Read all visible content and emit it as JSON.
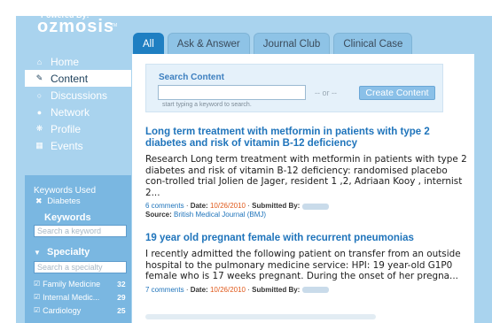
{
  "brand": {
    "powered_by": "Powered By:",
    "name": "ozmosis",
    "tm": "TM"
  },
  "tabs": [
    {
      "label": "All",
      "active": true
    },
    {
      "label": "Ask & Answer",
      "active": false
    },
    {
      "label": "Journal Club",
      "active": false
    },
    {
      "label": "Clinical Case",
      "active": false
    }
  ],
  "nav": [
    {
      "label": "Home",
      "icon": "home-icon",
      "active": false
    },
    {
      "label": "Content",
      "icon": "edit-icon",
      "active": true
    },
    {
      "label": "Discussions",
      "icon": "magnifier-icon",
      "active": false
    },
    {
      "label": "Network",
      "icon": "person-icon",
      "active": false
    },
    {
      "label": "Profile",
      "icon": "profile-gear-icon",
      "active": false
    },
    {
      "label": "Events",
      "icon": "calendar-icon",
      "active": false
    }
  ],
  "keywords_used": {
    "heading": "Keywords Used",
    "tags": [
      "Diabetes"
    ]
  },
  "keywords": {
    "title": "Keywords",
    "placeholder": "Search a keyword"
  },
  "specialty": {
    "title": "Specialty",
    "placeholder": "Search a specialty",
    "items": [
      {
        "name": "Family Medicine",
        "count": "32"
      },
      {
        "name": "Internal Medic...",
        "count": "29"
      },
      {
        "name": "Cardiology",
        "count": "25"
      }
    ]
  },
  "search": {
    "title": "Search Content",
    "hint": "start typing a keyword to search.",
    "or": "-- or --",
    "create_label": "Create Content"
  },
  "articles": [
    {
      "title": "Long term treatment with metformin in patients with type 2 diabetes and risk of vitamin B-12 deficiency",
      "body": "Research Long term treatment with metformin in patients with type 2 diabetes and risk of vitamin B-12 deficiency: randomised placebo con-trolled trial Jolien de Jager, resident 1 ,2, Adriaan Kooy , internist 2...",
      "comments": "6 comments",
      "date_label": "Date:",
      "date": "10/26/2010",
      "submitted_label": "Submitted By:",
      "source_label": "Source:",
      "source": "British Medical Journal (BMJ)"
    },
    {
      "title": "19 year old pregnant female with recurrent pneumonias",
      "body": "I recently admitted the following patient on transfer from an outside hospital to the pulmonary medicine service:   HPI: 19 year-old G1P0 female who is 17 weeks pregnant. During the onset of her pregna...",
      "comments": "7 comments",
      "date_label": "Date:",
      "date": "10/26/2010",
      "submitted_label": "Submitted By:"
    }
  ],
  "colors": {
    "frame": "#a9d3ee",
    "accent": "#1f7fc2",
    "link": "#1f74bb",
    "date": "#e05a1c"
  }
}
